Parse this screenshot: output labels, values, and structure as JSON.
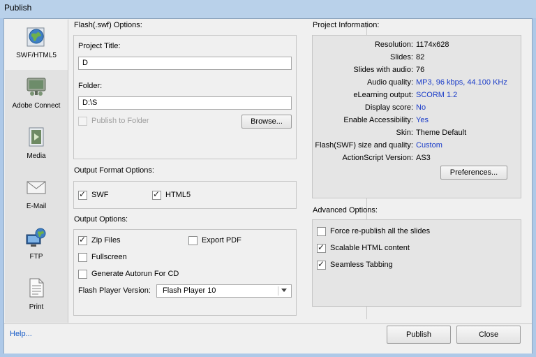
{
  "window": {
    "title": "Publish"
  },
  "sidebar": {
    "items": [
      {
        "label": "SWF/HTML5",
        "icon": "globe-icon"
      },
      {
        "label": "Adobe Connect",
        "icon": "adobe-connect-icon"
      },
      {
        "label": "Media",
        "icon": "media-film-icon"
      },
      {
        "label": "E-Mail",
        "icon": "email-envelope-icon"
      },
      {
        "label": "FTP",
        "icon": "ftp-network-icon"
      },
      {
        "label": "Print",
        "icon": "print-document-icon"
      }
    ]
  },
  "flash_options": {
    "title": "Flash(.swf) Options:",
    "project_title_label": "Project Title:",
    "project_title_value": "D",
    "folder_label": "Folder:",
    "folder_value": "D:\\S",
    "publish_to_folder_label": "Publish to Folder",
    "browse_label": "Browse..."
  },
  "output_format": {
    "title": "Output Format Options:",
    "swf_label": "SWF",
    "html5_label": "HTML5"
  },
  "output_options": {
    "title": "Output Options:",
    "zip_label": "Zip Files",
    "export_pdf_label": "Export PDF",
    "fullscreen_label": "Fullscreen",
    "autorun_label": "Generate Autorun For CD",
    "flash_version_label": "Flash Player Version:",
    "flash_version_value": "Flash Player 10"
  },
  "project_info": {
    "title": "Project Information:",
    "rows": [
      {
        "key": "Resolution:",
        "value": "1174x628"
      },
      {
        "key": "Slides:",
        "value": "82"
      },
      {
        "key": "Slides with audio:",
        "value": "76"
      },
      {
        "key": "Audio quality:",
        "value": "MP3, 96 kbps, 44.100 KHz"
      },
      {
        "key": "eLearning output:",
        "value": "SCORM 1.2"
      },
      {
        "key": "Display score:",
        "value": "No"
      },
      {
        "key": "Enable Accessibility:",
        "value": "Yes"
      },
      {
        "key": "Skin:",
        "value": "Theme Default"
      },
      {
        "key": "Flash(SWF) size and quality:",
        "value": "Custom"
      },
      {
        "key": "ActionScript Version:",
        "value": "AS3"
      }
    ],
    "preferences_label": "Preferences..."
  },
  "advanced": {
    "title": "Advanced Options:",
    "force_label": "Force re-publish all the slides",
    "scalable_label": "Scalable HTML content",
    "seamless_label": "Seamless Tabbing"
  },
  "footer": {
    "help_label": "Help...",
    "publish_label": "Publish",
    "close_label": "Close"
  }
}
